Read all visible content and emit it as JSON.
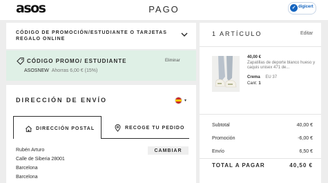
{
  "header": {
    "logo": "asos",
    "title": "PAGO",
    "badge": {
      "icon": "digicert-icon",
      "label": "digicert"
    }
  },
  "promo_section": {
    "title": "CÓDIGO DE PROMOCIÓN/ESTUDIANTE O TARJETAS REGALO ONLINE",
    "icon": "chevron-down-icon"
  },
  "promo_applied": {
    "title": "CÓDIGO PROMO/ ESTUDIANTE",
    "remove_label": "Eliminar",
    "code": "ASOSNEW",
    "saving": "Ahorras 6,00 € (15%)",
    "icon": "tag-icon",
    "bg_color": "#dff0e6"
  },
  "shipping": {
    "title": "DIRECCIÓN DE ENVÍO",
    "country_flag": "spain-flag-icon",
    "tabs": [
      {
        "label": "DIRECCIÓN POSTAL",
        "icon": "home-icon",
        "active": true
      },
      {
        "label": "RECOGE TU PEDIDO",
        "icon": "location-pin-icon",
        "active": false
      }
    ],
    "address_lines": [
      "Rubén Arturo",
      "Calle de Siberia 28001",
      "Barcelona",
      "Barcelona"
    ],
    "change_label": "CAMBIAR"
  },
  "summary": {
    "title": "1 ARTÍCULO",
    "edit_label": "Editar",
    "item": {
      "price": "40,00 €",
      "description": "Zapatillas de deporte blanco hueso y caquis unisex 471 de...",
      "color": "Crema",
      "size": "EU 37",
      "qty_label": "Cant:",
      "qty": "1"
    },
    "rows": [
      {
        "label": "Subtotal",
        "value": "40,00 €"
      },
      {
        "label": "Promoción",
        "value": "-6,00 €"
      },
      {
        "label": "Envío",
        "value": "6,50 €"
      }
    ],
    "total": {
      "label": "TOTAL A PAGAR",
      "value": "40,50 €"
    }
  }
}
